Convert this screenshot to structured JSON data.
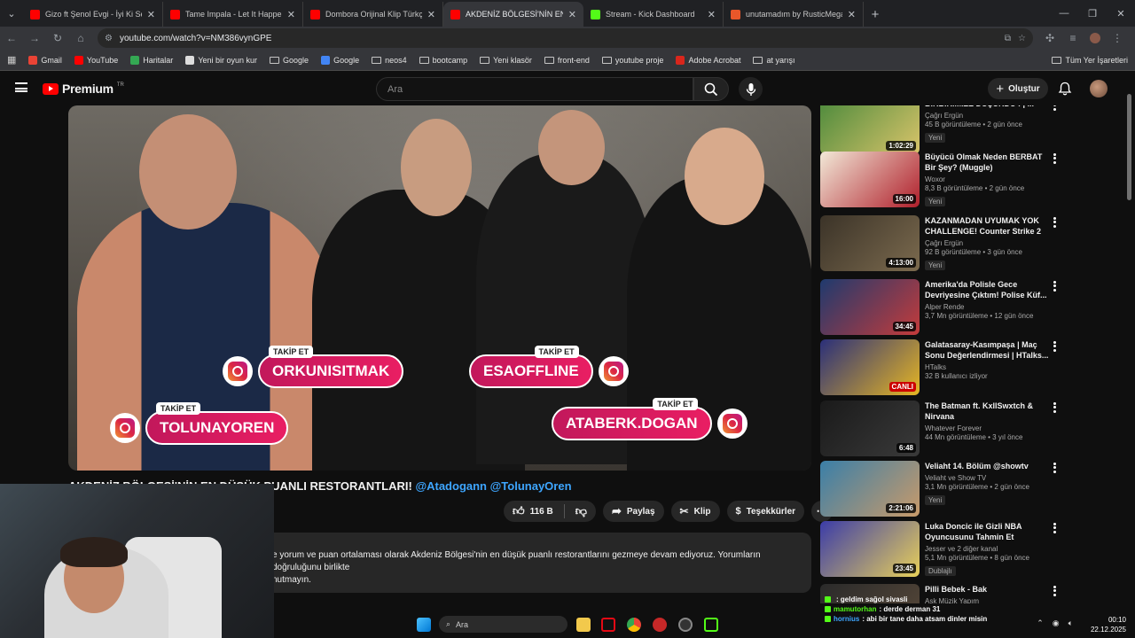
{
  "browser": {
    "tabs": [
      {
        "title": "Gizo ft Şenol Evgi - İyi Ki Sen #",
        "fav": "#ff0000"
      },
      {
        "title": "Tame Impala - Let It Happen (O",
        "fav": "#ff0000"
      },
      {
        "title": "Dombora Orijinal Klip Türkçesi",
        "fav": "#ff0000"
      },
      {
        "title": "AKDENİZ BÖLGESİ'NİN EN DÜŞ",
        "fav": "#ff0000",
        "active": true
      },
      {
        "title": "Stream - Kick Dashboard",
        "fav": "#53fc18"
      },
      {
        "title": "unutamadım by RusticMegaph",
        "fav": "#e8572a"
      }
    ],
    "url": "youtube.com/watch?v=NM386vynGPE",
    "bookmarks": [
      {
        "label": "Gmail",
        "kind": "icon",
        "color": "#ea4335"
      },
      {
        "label": "YouTube",
        "kind": "icon",
        "color": "#ff0000"
      },
      {
        "label": "Haritalar",
        "kind": "icon",
        "color": "#34a853"
      },
      {
        "label": "Yeni bir oyun kur",
        "kind": "icon",
        "color": "#dddddd"
      },
      {
        "label": "Google",
        "kind": "folder"
      },
      {
        "label": "Google",
        "kind": "icon",
        "color": "#4285f4"
      },
      {
        "label": "neos4",
        "kind": "folder"
      },
      {
        "label": "bootcamp",
        "kind": "folder"
      },
      {
        "label": "Yeni klasör",
        "kind": "folder"
      },
      {
        "label": "front-end",
        "kind": "folder"
      },
      {
        "label": "youtube proje",
        "kind": "folder"
      },
      {
        "label": "Adobe Acrobat",
        "kind": "icon",
        "color": "#d9261c"
      },
      {
        "label": "at yarışı",
        "kind": "folder"
      }
    ],
    "all_bookmarks": "Tüm Yer İşaretleri"
  },
  "yt": {
    "logo": "Premium",
    "logo_sup": "TR",
    "search_placeholder": "Ara",
    "create": "Oluştur"
  },
  "overlay": {
    "follow": "TAKİP ET",
    "handles": [
      "ORKUNISITMAK",
      "ESAOFFLINE",
      "TOLUNAYOREN",
      "ATABERK.DOGAN"
    ]
  },
  "video": {
    "title": "AKDENİZ BÖLGESİ'NİN EN DÜŞÜK PUANLI RESTORANTLARI!",
    "tag1": "@Atadogann",
    "tag2": "@TolunayOren",
    "likes": "116 B",
    "share": "Paylaş",
    "clip": "Klip",
    "thanks": "Teşekkürler",
    "desc1": "e yorum ve puan ortalaması olarak Akdeniz Bölgesi'nin en düşük puanlı restorantlarını gezmeye devam ediyoruz. Yorumların doğruluğunu birlikte",
    "desc2": "nutmayın."
  },
  "sidebar": [
    {
      "title": "BİRBİRİMİZE DÜŞÜRDÜ ! | ...",
      "channel": "Çağrı Ergün",
      "views": "45 B görüntüleme • 2 gün önce",
      "badge": "Yeni",
      "dur": "1:02:29",
      "c1": "#4c8a3c",
      "c2": "#d9c46a"
    },
    {
      "title": "Büyücü Olmak Neden BERBAT Bir Şey? (Muggle)",
      "channel": "Woxor",
      "views": "8,3 B görüntüleme • 2 gün önce",
      "badge": "Yeni",
      "dur": "16:00",
      "c1": "#f2e9d8",
      "c2": "#b01f2b"
    },
    {
      "title": "KAZANMADAN UYUMAK YOK CHALLENGE! Counter Strike 2 ...",
      "channel": "Çağrı Ergün",
      "views": "92 B görüntüleme • 3 gün önce",
      "badge": "Yeni",
      "dur": "4:13:00",
      "c1": "#3b3328",
      "c2": "#7b6a4e"
    },
    {
      "title": "Amerika'da Polisle Gece Devriyesine Çıktım! Polise Küf...",
      "channel": "Alper Rende",
      "views": "3,7 Mn görüntüleme • 12 gün önce",
      "badge": "",
      "dur": "34:45",
      "c1": "#1f3a6e",
      "c2": "#c43b3b"
    },
    {
      "title": "Galatasaray-Kasımpaşa | Maç Sonu Değerlendirmesi | HTalks...",
      "channel": "HTalks",
      "views": "32 B kullanıcı izliyor",
      "badge": "",
      "dur": "CANLI",
      "c1": "#2a2f7a",
      "c2": "#e6b624"
    },
    {
      "title": "The Batman ft. KxllSwxtch & Nirvana",
      "channel": "Whatever Forever",
      "views": "44 Mn görüntüleme • 3 yıl önce",
      "badge": "",
      "dur": "6:48",
      "c1": "#1a1a1a",
      "c2": "#3a3a3a"
    },
    {
      "title": "Veliaht 14. Bölüm @showtv",
      "channel": "Veliaht ve Show TV",
      "views": "3,1 Mn görüntüleme • 2 gün önce",
      "badge": "Yeni",
      "dur": "2:21:06",
      "c1": "#3a7fa8",
      "c2": "#c89a6a"
    },
    {
      "title": "Luka Doncic ile Gizli NBA Oyuncusunu Tahmin Et",
      "channel": "Jesser ve 2 diğer kanal",
      "views": "5,1 Mn görüntüleme • 8 gün önce",
      "badge": "Dublajlı",
      "dur": "23:45",
      "c1": "#3b3ca8",
      "c2": "#e8d05a"
    },
    {
      "title": "Pilli Bebek - Bak",
      "channel": "Aşk Müzik Yapım",
      "views": "",
      "badge": "",
      "dur": "",
      "c1": "#2a2a2a",
      "c2": "#5a4a3a"
    }
  ],
  "chat": [
    {
      "user": "",
      "msg": ": geldim sağol sivasli",
      "color": "#e04040"
    },
    {
      "user": "mamutorhan",
      "msg": ": derde derman 31",
      "color": "#53fc18"
    },
    {
      "user": "hornius",
      "msg": ": abi bir tane daha atsam dinler misin",
      "color": "#3ea6ff"
    }
  ],
  "taskbar": {
    "search": "Ara",
    "time": "00:10",
    "date": "22.12.2025"
  }
}
